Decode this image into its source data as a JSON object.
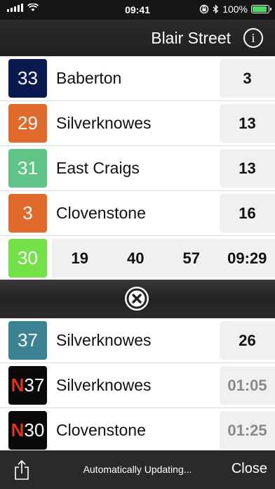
{
  "status_bar": {
    "time": "09:41",
    "battery": "100%",
    "battery_level": 1.0
  },
  "nav": {
    "title": "Blair Street",
    "info_icon": "i"
  },
  "upper_departures": [
    {
      "route": "33",
      "color": "#0b1a4e",
      "destination": "Baberton",
      "due": "3"
    },
    {
      "route": "29",
      "color": "#e06a2b",
      "destination": "Silverknowes",
      "due": "13"
    },
    {
      "route": "31",
      "color": "#5fc486",
      "destination": "East Craigs",
      "due": "13"
    },
    {
      "route": "3",
      "color": "#e06a2b",
      "destination": "Clovenstone",
      "due": "16"
    }
  ],
  "route30": {
    "route": "30",
    "color": "#74e04a",
    "times": [
      "19",
      "40",
      "57",
      "09:29"
    ]
  },
  "lower_departures": [
    {
      "route": "37",
      "color": "#3b8293",
      "night": false,
      "destination": "Silverknowes",
      "due": "26",
      "due_style": "dark"
    },
    {
      "route_prefix": "N",
      "route": "37",
      "color": "#0a0a0a",
      "night": true,
      "destination": "Silverknowes",
      "due": "01:05",
      "due_style": "grey"
    },
    {
      "route_prefix": "N",
      "route": "30",
      "color": "#0a0a0a",
      "night": true,
      "destination": "Clovenstone",
      "due": "01:25",
      "due_style": "grey"
    }
  ],
  "toolbar": {
    "status_text": "Automatically Updating...",
    "close_label": "Close"
  }
}
